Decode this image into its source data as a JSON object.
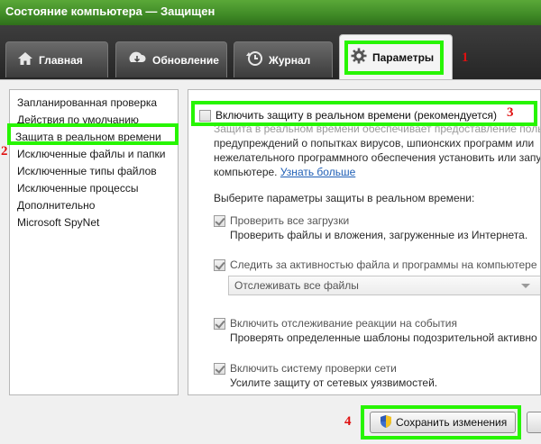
{
  "window": {
    "title": "Состояние компьютера — Защищен"
  },
  "tabs": [
    {
      "label": "Главная",
      "icon": "home-icon",
      "active": false
    },
    {
      "label": "Обновление",
      "icon": "update-icon",
      "active": false
    },
    {
      "label": "Журнал",
      "icon": "history-icon",
      "active": false
    },
    {
      "label": "Параметры",
      "icon": "gear-icon",
      "active": true
    }
  ],
  "sidebar": {
    "items": [
      {
        "label": "Запланированная проверка"
      },
      {
        "label": "Действия по умолчанию"
      },
      {
        "label": "Защита в реальном времени",
        "selected": true
      },
      {
        "label": "Исключенные файлы и папки"
      },
      {
        "label": "Исключенные типы файлов"
      },
      {
        "label": "Исключенные процессы"
      },
      {
        "label": "Дополнительно"
      },
      {
        "label": "Microsoft SpyNet"
      }
    ]
  },
  "main": {
    "enable_realtime": {
      "label": "Включить защиту в реальном времени (рекомендуется)",
      "checked": false
    },
    "intro_lines": [
      "Защита в реальном времени обеспечивает предоставление поль",
      "предупреждений о попытках вирусов, шпионских программ или ",
      "нежелательного программного обеспечения установить или запу"
    ],
    "intro_last_line": "компьютере.",
    "learn_more_link": "Узнать больше",
    "choose_params_label": "Выберите параметры защиты в реальном времени:",
    "scan_downloads": {
      "label": "Проверить все загрузки",
      "description": "Проверить файлы и вложения, загруженные из Интернета.",
      "checked": true
    },
    "monitor_activity": {
      "label": "Следить за активностью файла и программы на компьютере",
      "checked": true
    },
    "monitor_select": {
      "value": "Отслеживать все файлы"
    },
    "event_tracking": {
      "label": "Включить отслеживание реакции на события",
      "description": "Проверять определенные шаблоны подозрительной активно",
      "checked": true
    },
    "network_inspection": {
      "label": "Включить систему проверки сети",
      "description": "Усилите защиту от сетевых уязвимостей.",
      "checked": true
    }
  },
  "footer": {
    "save_label": "Сохранить изменения"
  },
  "annotations": {
    "n1": "1",
    "n2": "2",
    "n3": "3",
    "n4": "4",
    "highlight_color": "#27f500",
    "number_color": "#e01010"
  },
  "colors": {
    "titlebar": "#4a9a2e",
    "link": "#1f5fb6"
  }
}
